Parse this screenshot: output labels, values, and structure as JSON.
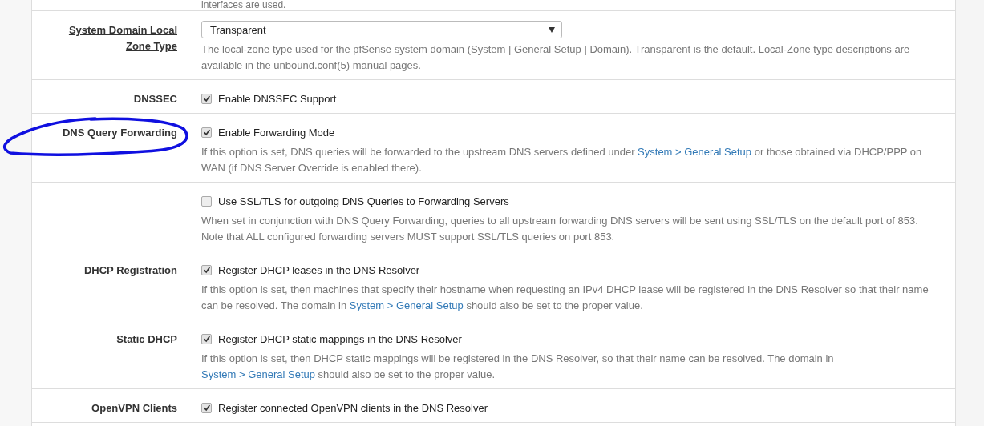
{
  "top_help": "interfaces are used.",
  "rows": [
    {
      "label": "System Domain Local Zone Type",
      "label_link": true,
      "control": {
        "kind": "select",
        "value": "Transparent"
      },
      "help": [
        {
          "text": "The local-zone type used for the pfSense system domain (System | General Setup | Domain). Transparent is the default. Local-Zone type descriptions are available in the unbound.conf(5) manual pages.",
          "link": false
        }
      ]
    },
    {
      "label": "DNSSEC",
      "label_link": false,
      "control": {
        "kind": "checkbox",
        "checked": true,
        "label": "Enable DNSSEC Support"
      },
      "help": []
    },
    {
      "label": "DNS Query Forwarding",
      "label_link": false,
      "circled": true,
      "control": {
        "kind": "checkbox",
        "checked": true,
        "label": "Enable Forwarding Mode"
      },
      "help": [
        {
          "text": "If this option is set, DNS queries will be forwarded to the upstream DNS servers defined under ",
          "link": false
        },
        {
          "text": "System > General Setup",
          "link": true
        },
        {
          "text": " or those obtained via DHCP/PPP on WAN (if DNS Server Override is enabled there).",
          "link": false
        }
      ]
    },
    {
      "control": {
        "kind": "checkbox",
        "checked": false,
        "label": "Use SSL/TLS for outgoing DNS Queries to Forwarding Servers"
      },
      "help": [
        {
          "text": "When set in conjunction with DNS Query Forwarding, queries to all upstream forwarding DNS servers will be sent using SSL/TLS on the default port of 853. Note that ALL configured forwarding servers MUST support SSL/TLS queries on port 853.",
          "link": false
        }
      ]
    },
    {
      "label": "DHCP Registration",
      "label_link": false,
      "control": {
        "kind": "checkbox",
        "checked": true,
        "label": "Register DHCP leases in the DNS Resolver"
      },
      "help": [
        {
          "text": "If this option is set, then machines that specify their hostname when requesting an IPv4 DHCP lease will be registered in the DNS Resolver so that their name can be resolved. The domain in ",
          "link": false
        },
        {
          "text": "System > General Setup",
          "link": true
        },
        {
          "text": " should also be set to the proper value.",
          "link": false
        }
      ]
    },
    {
      "label": "Static DHCP",
      "label_link": false,
      "control": {
        "kind": "checkbox",
        "checked": true,
        "label": "Register DHCP static mappings in the DNS Resolver"
      },
      "help": [
        {
          "text": "If this option is set, then DHCP static mappings will be registered in the DNS Resolver, so that their name can be resolved. The domain in ",
          "link": false
        },
        {
          "text": "System > General Setup",
          "link": true
        },
        {
          "text": " should also be set to the proper value.",
          "link": false
        }
      ]
    },
    {
      "label": "OpenVPN Clients",
      "label_link": false,
      "control": {
        "kind": "checkbox",
        "checked": true,
        "label": "Register connected OpenVPN clients in the DNS Resolver"
      },
      "help": []
    }
  ]
}
